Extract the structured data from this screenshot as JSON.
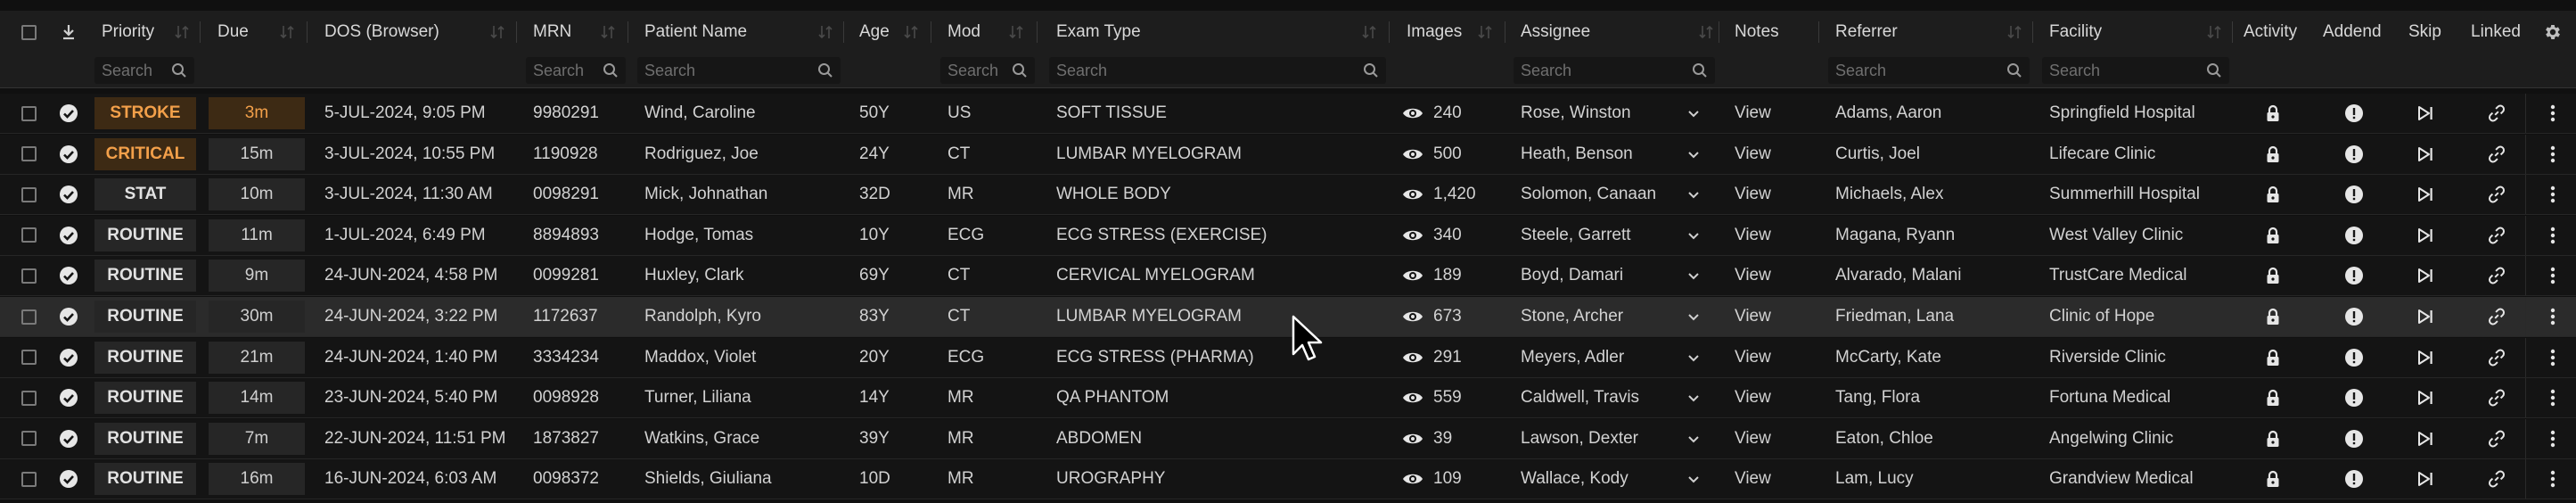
{
  "colors": {
    "stroke_badge_bg": "#3d2a14",
    "stroke_badge_fg": "#f3a04a",
    "critical_badge_bg": "#3d2a14",
    "critical_badge_fg": "#f3a04a",
    "routine_badge_bg": "#262626",
    "routine_badge_fg": "#e2e2e2"
  },
  "columns": {
    "priority": "Priority",
    "due": "Due",
    "dos": "DOS (Browser)",
    "mrn": "MRN",
    "patient": "Patient Name",
    "age": "Age",
    "mod": "Mod",
    "exam": "Exam Type",
    "images": "Images",
    "assignee": "Assignee",
    "notes": "Notes",
    "referrer": "Referrer",
    "facility": "Facility",
    "activity": "Activity",
    "addend": "Addend",
    "skip": "Skip",
    "linked": "Linked"
  },
  "search_placeholder": "Search",
  "rows": [
    {
      "priority": "STROKE",
      "due": "3m",
      "dos": "5-JUL-2024, 9:05 PM",
      "mrn": "9980291",
      "patient": "Wind, Caroline",
      "age": "50Y",
      "mod": "US",
      "exam": "SOFT TISSUE",
      "images": "240",
      "assignee": "Rose, Winston",
      "notes": "View",
      "referrer": "Adams, Aaron",
      "facility": "Springfield Hospital",
      "selected": false
    },
    {
      "priority": "CRITICAL",
      "due": "15m",
      "dos": "3-JUL-2024, 10:55 PM",
      "mrn": "1190928",
      "patient": "Rodriguez, Joe",
      "age": "24Y",
      "mod": "CT",
      "exam": "LUMBAR MYELOGRAM",
      "images": "500",
      "assignee": "Heath, Benson",
      "notes": "View",
      "referrer": "Curtis, Joel",
      "facility": "Lifecare Clinic",
      "selected": false
    },
    {
      "priority": "STAT",
      "due": "10m",
      "dos": "3-JUL-2024, 11:30 AM",
      "mrn": "0098291",
      "patient": "Mick, Johnathan",
      "age": "32D",
      "mod": "MR",
      "exam": "WHOLE BODY",
      "images": "1,420",
      "assignee": "Solomon, Canaan",
      "notes": "View",
      "referrer": "Michaels, Alex",
      "facility": "Summerhill Hospital",
      "selected": false
    },
    {
      "priority": "ROUTINE",
      "due": "11m",
      "dos": "1-JUL-2024, 6:49 PM",
      "mrn": "8894893",
      "patient": "Hodge, Tomas",
      "age": "10Y",
      "mod": "ECG",
      "exam": "ECG STRESS (EXERCISE)",
      "images": "340",
      "assignee": "Steele, Garrett",
      "notes": "View",
      "referrer": "Magana, Ryann",
      "facility": "West Valley Clinic",
      "selected": false
    },
    {
      "priority": "ROUTINE",
      "due": "9m",
      "dos": "24-JUN-2024, 4:58 PM",
      "mrn": "0099281",
      "patient": "Huxley, Clark",
      "age": "69Y",
      "mod": "CT",
      "exam": "CERVICAL MYELOGRAM",
      "images": "189",
      "assignee": "Boyd, Damari",
      "notes": "View",
      "referrer": "Alvarado, Malani",
      "facility": "TrustCare Medical",
      "selected": false
    },
    {
      "priority": "ROUTINE",
      "due": "30m",
      "dos": "24-JUN-2024, 3:22 PM",
      "mrn": "1172637",
      "patient": "Randolph, Kyro",
      "age": "83Y",
      "mod": "CT",
      "exam": "LUMBAR MYELOGRAM",
      "images": "673",
      "assignee": "Stone, Archer",
      "notes": "View",
      "referrer": "Friedman, Lana",
      "facility": "Clinic of Hope",
      "selected": true
    },
    {
      "priority": "ROUTINE",
      "due": "21m",
      "dos": "24-JUN-2024, 1:40 PM",
      "mrn": "3334234",
      "patient": "Maddox, Violet",
      "age": "20Y",
      "mod": "ECG",
      "exam": "ECG STRESS (PHARMA)",
      "images": "291",
      "assignee": "Meyers, Adler",
      "notes": "View",
      "referrer": "McCarty, Kate",
      "facility": "Riverside Clinic",
      "selected": false
    },
    {
      "priority": "ROUTINE",
      "due": "14m",
      "dos": "23-JUN-2024, 5:40 PM",
      "mrn": "0098928",
      "patient": "Turner, Liliana",
      "age": "14Y",
      "mod": "MR",
      "exam": "QA PHANTOM",
      "images": "559",
      "assignee": "Caldwell, Travis",
      "notes": "View",
      "referrer": "Tang, Flora",
      "facility": "Fortuna Medical",
      "selected": false
    },
    {
      "priority": "ROUTINE",
      "due": "7m",
      "dos": "22-JUN-2024, 11:51 PM",
      "mrn": "1873827",
      "patient": "Watkins, Grace",
      "age": "39Y",
      "mod": "MR",
      "exam": "ABDOMEN",
      "images": "39",
      "assignee": "Lawson, Dexter",
      "notes": "View",
      "referrer": "Eaton, Chloe",
      "facility": "Angelwing Clinic",
      "selected": false
    },
    {
      "priority": "ROUTINE",
      "due": "16m",
      "dos": "16-JUN-2024, 6:03 AM",
      "mrn": "0098372",
      "patient": "Shields, Giuliana",
      "age": "10D",
      "mod": "MR",
      "exam": "UROGRAPHY",
      "images": "109",
      "assignee": "Wallace, Kody",
      "notes": "View",
      "referrer": "Lam, Lucy",
      "facility": "Grandview Medical",
      "selected": false
    }
  ]
}
